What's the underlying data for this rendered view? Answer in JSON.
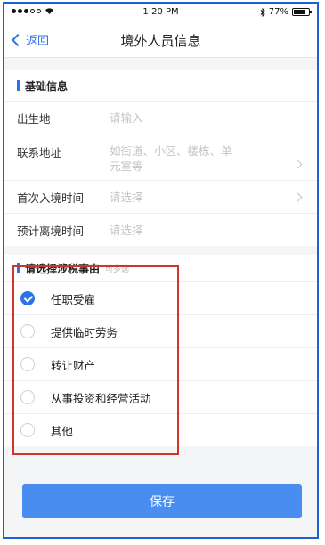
{
  "status_bar": {
    "time": "1:20 PM",
    "battery": "77%"
  },
  "nav": {
    "back_label": "返回",
    "title": "境外人员信息"
  },
  "basic_info": {
    "header": "基础信息",
    "fields": [
      {
        "label": "出生地",
        "value": "请输入"
      },
      {
        "label": "联系地址",
        "value_line1": "如街道、小区、楼栋、单",
        "value_line2": "元室等"
      },
      {
        "label": "首次入境时间",
        "value": "请选择"
      },
      {
        "label": "预计离境时间",
        "value": "请选择"
      }
    ]
  },
  "tax_reason": {
    "header": "请选择涉税事由",
    "hint": "可多选",
    "options": [
      {
        "label": "任职受雇",
        "checked": true
      },
      {
        "label": "提供临时劳务",
        "checked": false
      },
      {
        "label": "转让财产",
        "checked": false
      },
      {
        "label": "从事投资和经营活动",
        "checked": false
      },
      {
        "label": "其他",
        "checked": false
      }
    ]
  },
  "save_button": "保存",
  "colors": {
    "accent": "#2b73e8",
    "save_button": "#4a8df0",
    "highlight": "#d0342c",
    "frame_border": "#1e5fd6"
  }
}
